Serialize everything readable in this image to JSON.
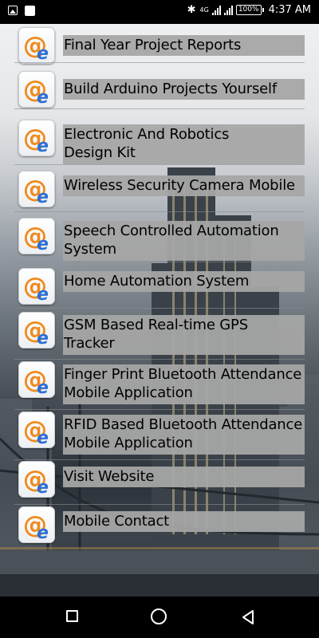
{
  "status_bar": {
    "time": "4:37 AM",
    "battery": "100%",
    "network": "4G",
    "icons": [
      "image-icon",
      "square-icon",
      "bluetooth-icon",
      "signal-icon",
      "signal-icon",
      "battery-icon"
    ]
  },
  "menu": {
    "icon": "at-e-icon",
    "items": [
      {
        "label": "Final Year Project Reports"
      },
      {
        "label": "Build Arduino Projects Yourself"
      },
      {
        "label": "Electronic And Robotics\nDesign Kit"
      },
      {
        "label": "Wireless Security Camera Mobile"
      },
      {
        "label": "Speech Controlled Automation\nSystem"
      },
      {
        "label": "Home Automation System"
      },
      {
        "label": "GSM Based Real-time GPS\nTracker"
      },
      {
        "label": "Finger Print Bluetooth Attendance\nMobile Application"
      },
      {
        "label": "RFID Based Bluetooth Attendance\nMobile Application"
      },
      {
        "label": "Visit Website"
      },
      {
        "label": "Mobile Contact"
      }
    ]
  },
  "nav_bar": {
    "icons": [
      "recents-icon",
      "home-icon",
      "back-icon"
    ]
  },
  "colors": {
    "label_bg": "#a6a6a6",
    "icon_orange": "#f08a1c",
    "icon_blue": "#2b6fd6"
  }
}
